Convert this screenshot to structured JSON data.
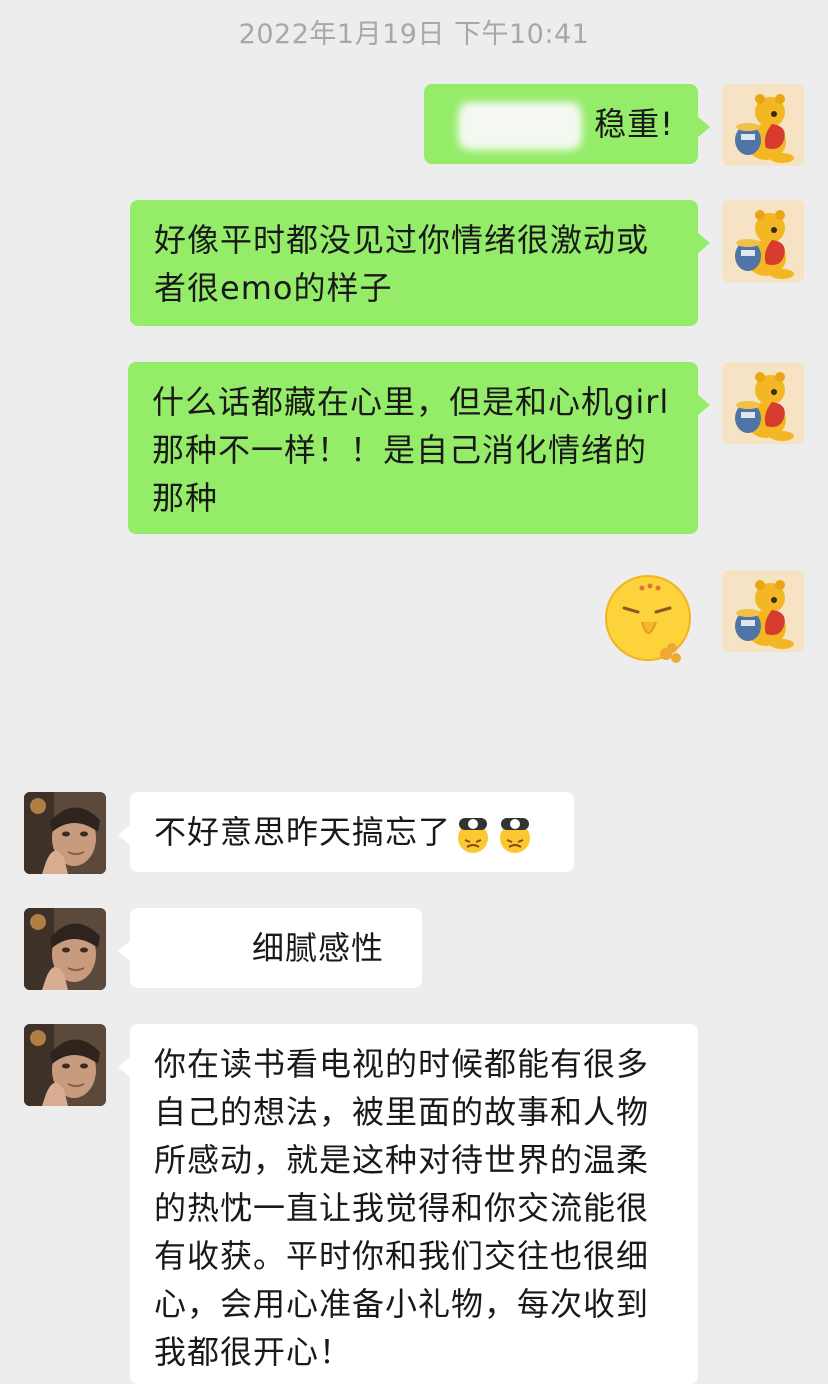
{
  "header": {
    "timestamp": "2022年1月19日 下午10:41"
  },
  "messages": {
    "m1": {
      "text": "稳重!"
    },
    "m2": {
      "text": "好像平时都没见过你情绪很激动或者很emo的样子"
    },
    "m3": {
      "text": "什么话都藏在心里，但是和心机girl那种不一样！！是自己消化情绪的那种"
    },
    "m4": {
      "sticker": "shy-pleading-face-emoji"
    },
    "m5": {
      "text": "不好意思昨天搞忘了",
      "emoji": "frustrated-lantern-emoji"
    },
    "m6": {
      "text": "细腻感性"
    },
    "m7": {
      "text": "你在读书看电视的时候都能有很多自己的想法，被里面的故事和人物所感动，就是这种对待世界的温柔的热忱一直让我觉得和你交流能很有收获。平时你和我们交往也很细心，会用心准备小礼物，每次收到我都很开心！"
    }
  },
  "avatars": {
    "self": "winnie-the-pooh-avatar",
    "other": "person-photo-avatar"
  },
  "colors": {
    "background": "#ededed",
    "outgoing_bubble": "#95ec69",
    "incoming_bubble": "#ffffff",
    "timestamp_text": "#a8a8a8"
  }
}
